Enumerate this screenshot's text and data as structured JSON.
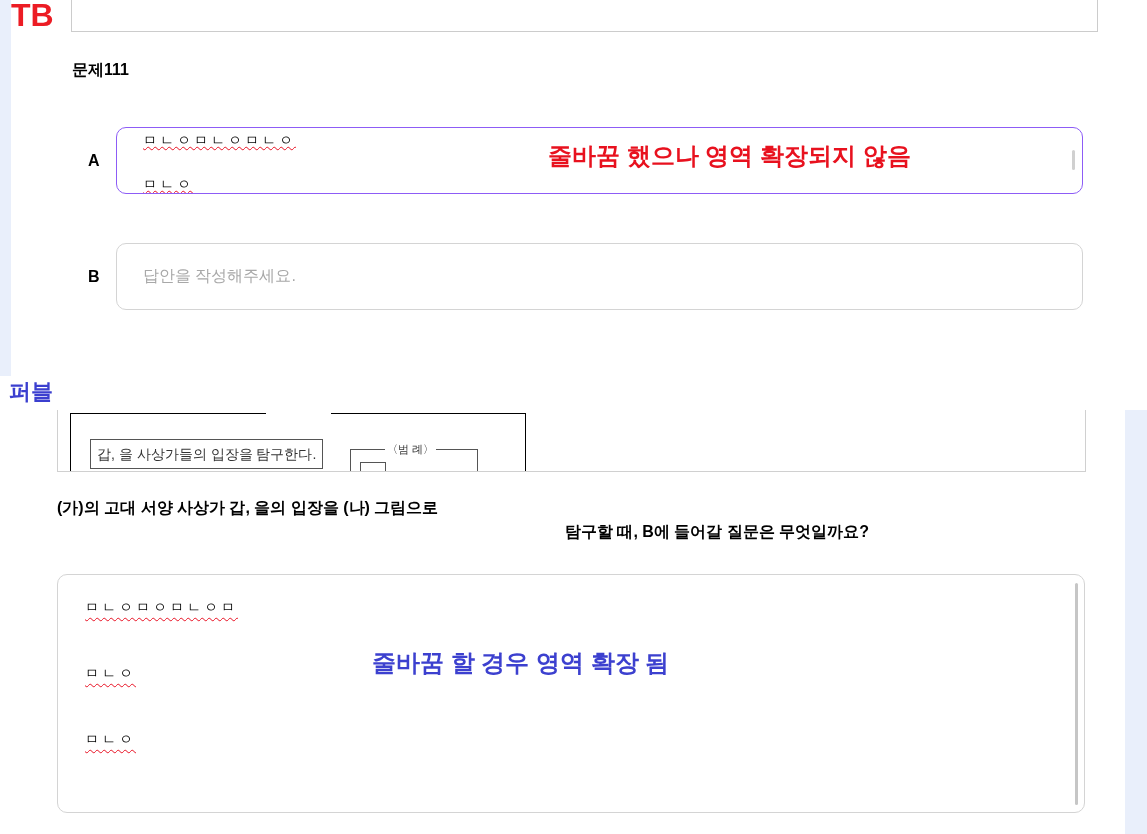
{
  "tb_section": {
    "tag": "TB",
    "problem_title": "문제111",
    "answers": [
      {
        "label": "A",
        "focused": true,
        "lines": [
          {
            "text": "ㅁㄴㅇㅁㄴㅇㅁㄴㅇ",
            "misspelled": true
          },
          {
            "text": "ㅁㄴㅇ",
            "misspelled": true
          }
        ],
        "note": "줄바꿈 했으나 영역 확장되지 않음"
      },
      {
        "label": "B",
        "focused": false,
        "placeholder": "답안을 작성해주세요."
      }
    ]
  },
  "publishing_section": {
    "tag": "퍼블",
    "figure": {
      "statement": "갑, 을 사상가들의 입장을 탐구한다.",
      "legend_title": "〈범 례〉"
    },
    "question_lines": [
      "(가)의 고대 서양 사상가 갑, 을의 입장을 (나) 그림으로",
      "탐구할 때, B에 들어갈 질문은 무엇일까요?"
    ],
    "answer": {
      "focused": false,
      "lines": [
        {
          "text": "ㅁㄴㅇㅁㅇㅁㄴㅇㅁ",
          "misspelled": true
        },
        {
          "text": "ㅁㄴㅇ",
          "misspelled": true
        },
        {
          "text": "ㅁㄴㅇ",
          "misspelled": true
        }
      ],
      "note": "줄바꿈 할 경우 영역 확장 됨"
    }
  }
}
